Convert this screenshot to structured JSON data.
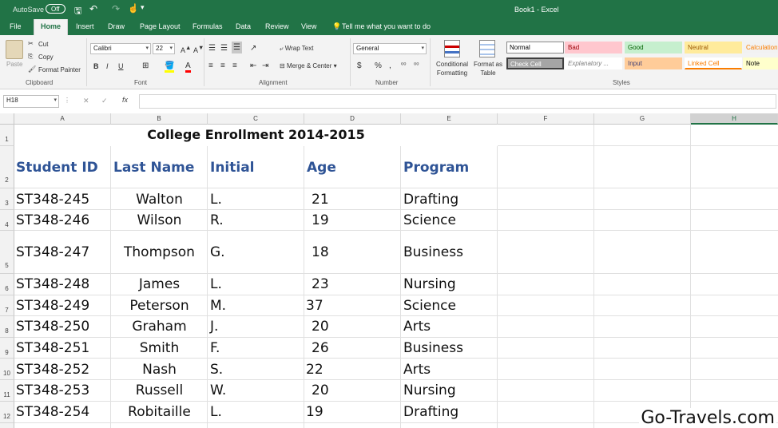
{
  "titlebar": {
    "autosave": "AutoSave",
    "autosave_state": "Off",
    "title": "Book1 - Excel"
  },
  "tabs": [
    "File",
    "Home",
    "Insert",
    "Draw",
    "Page Layout",
    "Formulas",
    "Data",
    "Review",
    "View"
  ],
  "tell_me": "Tell me what you want to do",
  "clipboard": {
    "paste": "Paste",
    "cut": "Cut",
    "copy": "Copy",
    "format_painter": "Format Painter",
    "group": "Clipboard"
  },
  "font": {
    "name": "Calibri",
    "size": "22",
    "bold": "B",
    "italic": "I",
    "underline": "U",
    "group": "Font"
  },
  "alignment": {
    "wrap": "Wrap Text",
    "merge": "Merge & Center",
    "group": "Alignment"
  },
  "number": {
    "format": "General",
    "currency": "$",
    "percent": "%",
    "comma": ",",
    "group": "Number"
  },
  "styles": {
    "conditional": "Conditional Formatting",
    "format_table": "Format as Table",
    "group": "Styles",
    "cells": [
      {
        "label": "Normal",
        "bg": "#ffffff",
        "fg": "#000000"
      },
      {
        "label": "Bad",
        "bg": "#ffc7ce",
        "fg": "#9c0006"
      },
      {
        "label": "Good",
        "bg": "#c6efce",
        "fg": "#006100"
      },
      {
        "label": "Neutral",
        "bg": "#ffeb9c",
        "fg": "#9c5700"
      },
      {
        "label": "Calculation",
        "bg": "#f2f2f2",
        "fg": "#fa7d00"
      },
      {
        "label": "Check Cell",
        "bg": "#a5a5a5",
        "fg": "#ffffff"
      },
      {
        "label": "Explanatory ...",
        "bg": "#ffffff",
        "fg": "#7f7f7f"
      },
      {
        "label": "Input",
        "bg": "#ffcc99",
        "fg": "#3f3f76"
      },
      {
        "label": "Linked Cell",
        "bg": "#ffffff",
        "fg": "#fa7d00"
      },
      {
        "label": "Note",
        "bg": "#ffffcc",
        "fg": "#000000"
      }
    ]
  },
  "formula_bar": {
    "name_box": "H18",
    "fx": "fx",
    "cancel": "✕",
    "enter": "✓",
    "value": ""
  },
  "columns": [
    "A",
    "B",
    "C",
    "D",
    "E",
    "F",
    "G",
    "H"
  ],
  "rows": [
    "1",
    "2",
    "3",
    "4",
    "5",
    "6",
    "7",
    "8",
    "9",
    "10",
    "11",
    "12"
  ],
  "sheet": {
    "title": "College Enrollment 2014-2015",
    "headers": [
      "Student ID",
      "Last Name",
      "Initial",
      "Age",
      "Program"
    ],
    "data": [
      [
        "ST348-245",
        "Walton",
        "L.",
        "21",
        "Drafting"
      ],
      [
        "ST348-246",
        "Wilson",
        "R.",
        "19",
        "Science"
      ],
      [
        "ST348-247",
        "Thompson",
        "G.",
        "18",
        "Business"
      ],
      [
        "ST348-248",
        "James",
        "L.",
        "23",
        "Nursing"
      ],
      [
        "ST348-249",
        "Peterson",
        "M.",
        "37",
        "Science"
      ],
      [
        "ST348-250",
        "Graham",
        "J.",
        "20",
        "Arts"
      ],
      [
        "ST348-251",
        "Smith",
        "F.",
        "26",
        "Business"
      ],
      [
        "ST348-252",
        "Nash",
        "S.",
        "22",
        "Arts"
      ],
      [
        "ST348-253",
        "Russell",
        "W.",
        "20",
        "Nursing"
      ],
      [
        "ST348-254",
        "Robitaille",
        "L.",
        "19",
        "Drafting"
      ]
    ]
  },
  "watermark": "Go-Travels.com",
  "accent": "#217346",
  "header_color": "#2f5496"
}
